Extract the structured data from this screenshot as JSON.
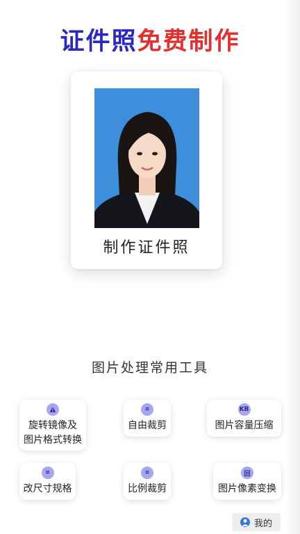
{
  "header": {
    "title_part1": "证件照",
    "title_part2": "免费制作",
    "colors": {
      "part1": "#2a27c2",
      "part2": "#e2302f"
    }
  },
  "hero_card": {
    "label": "制作证件照",
    "photo_background": "#3d8fdb"
  },
  "tools_section": {
    "title": "图片处理常用工具",
    "tools": [
      {
        "icon": "mirror-rotate-icon",
        "icon_text": "",
        "line1": "旋转镜像及",
        "line2": "图片格式转换"
      },
      {
        "icon": "crop-icon",
        "icon_text": "⌗",
        "line1": "自由裁剪",
        "line2": ""
      },
      {
        "icon": "kb-compress-icon",
        "icon_text": "KB",
        "line1": "图片容量压缩",
        "line2": ""
      },
      {
        "icon": "crop-icon",
        "icon_text": "⌗",
        "line1": "改尺寸规格",
        "line2": ""
      },
      {
        "icon": "crop-icon",
        "icon_text": "⌗",
        "line1": "比例裁剪",
        "line2": ""
      },
      {
        "icon": "pixel-icon",
        "icon_text": "回",
        "line1": "图片像素变换",
        "line2": ""
      }
    ]
  },
  "footer": {
    "mine_label": "我的"
  }
}
